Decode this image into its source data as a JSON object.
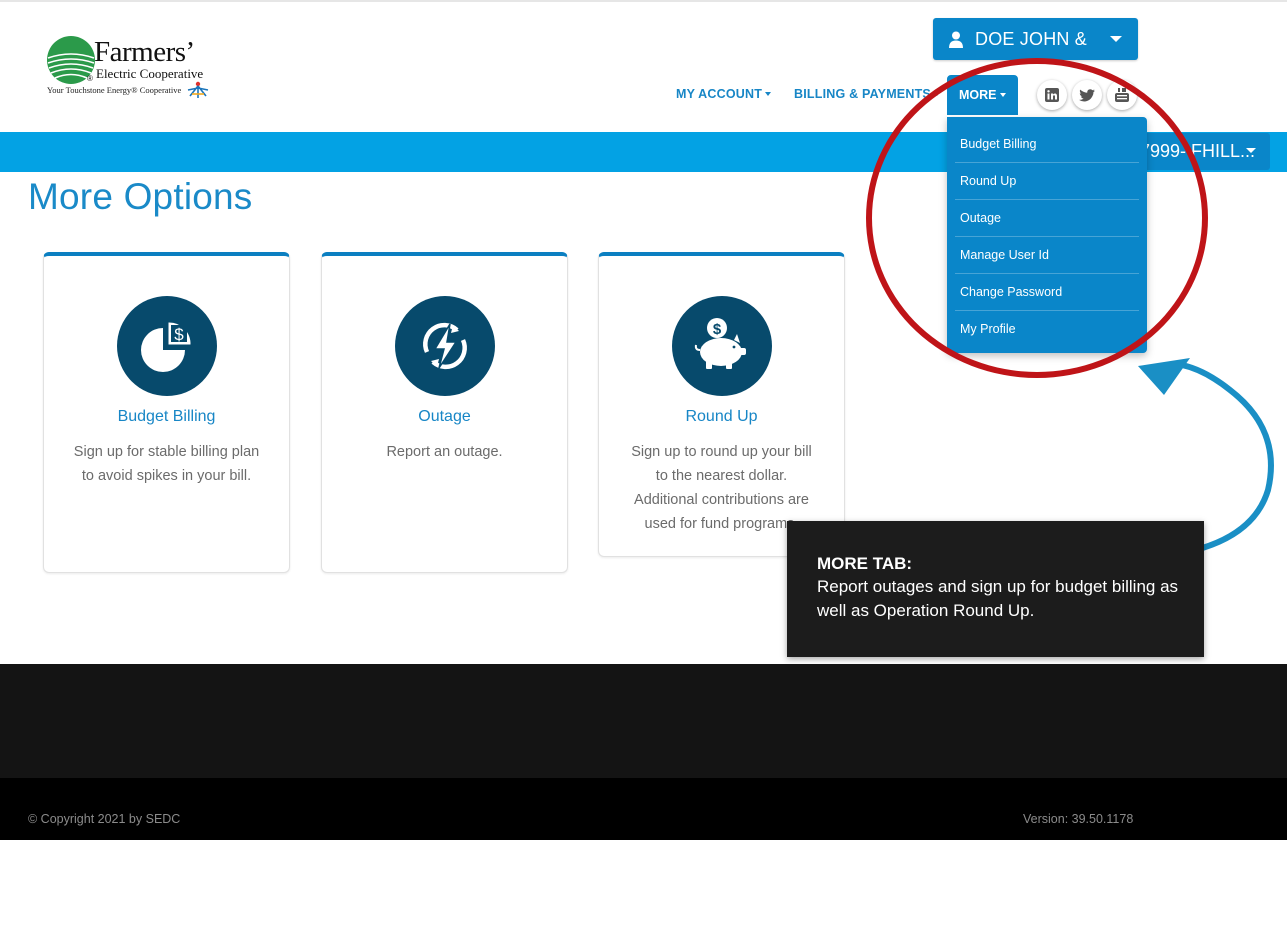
{
  "logo": {
    "name": "Farmers’",
    "subtitle": "Electric Cooperative",
    "tagline": "Your Touchstone Energy® Cooperative",
    "reg_mark": "®"
  },
  "account": {
    "name": "DOE JOHN &"
  },
  "nav": {
    "items": [
      {
        "label": "MY ACCOUNT"
      },
      {
        "label": "BILLING & PAYMENTS"
      },
      {
        "label": "MORE"
      }
    ]
  },
  "social": [
    "linkedin-icon",
    "twitter-icon",
    "youtube-icon"
  ],
  "account_select": {
    "value": "7999- FHILL..."
  },
  "page": {
    "title": "More Options"
  },
  "cards": [
    {
      "title": "Budget Billing",
      "description": "Sign up for stable billing plan to avoid spikes in your bill.",
      "icon": "pie-chart-dollar-icon"
    },
    {
      "title": "Outage",
      "description": "Report an outage.",
      "icon": "lightning-icon"
    },
    {
      "title": "Round Up",
      "description": "Sign up to round up your bill to the nearest dollar. Additional contributions are used for fund programs.",
      "icon": "piggy-bank-icon"
    }
  ],
  "dropdown": {
    "items": [
      "Budget Billing",
      "Round Up",
      "Outage",
      "Manage User Id",
      "Change Password",
      "My Profile"
    ]
  },
  "callout": {
    "title": "MORE TAB:",
    "body": "Report outages and sign up for budget billing as well as Operation Round Up."
  },
  "footer": {
    "copyright": "© Copyright 2021 by SEDC",
    "version": "Version: 39.50.1178"
  },
  "colors": {
    "primary": "#0a86c9",
    "band": "#03a2e4",
    "icon_circle": "#074a6c",
    "annotation_red": "#bf1418",
    "annotation_arrow": "#1a8fc5",
    "footer": "#141414"
  }
}
